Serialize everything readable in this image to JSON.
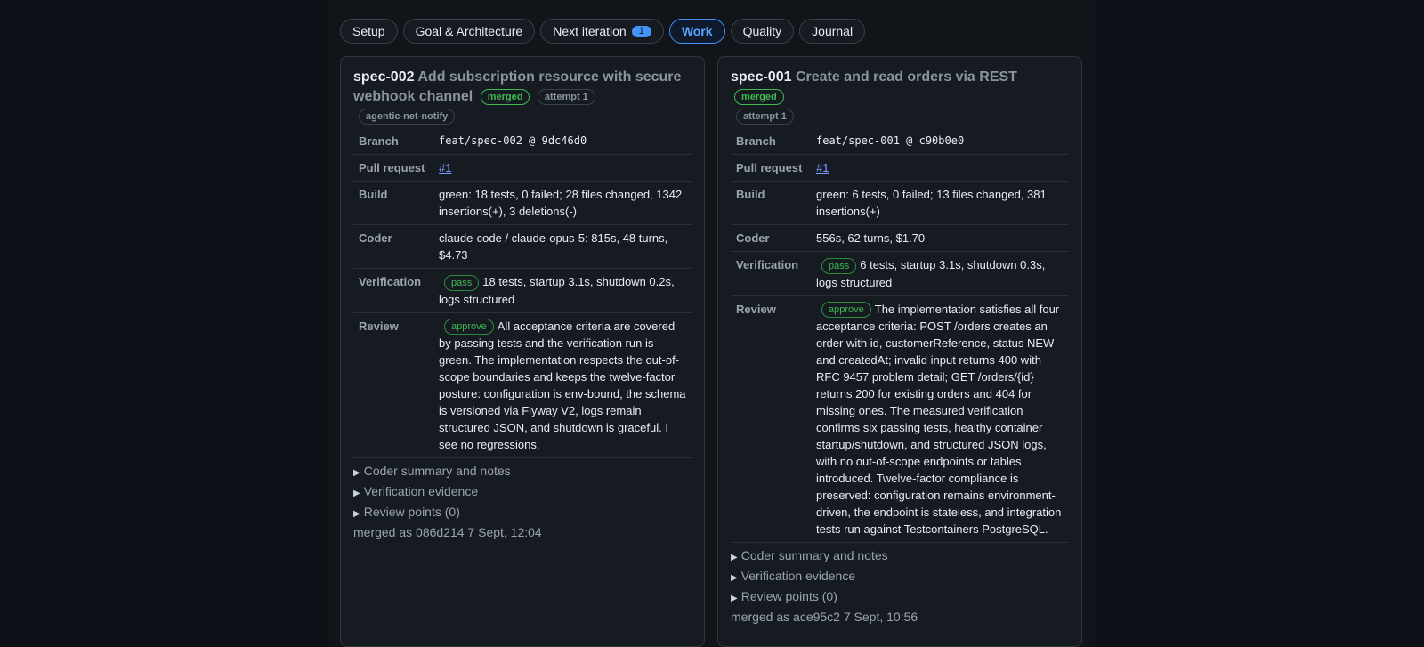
{
  "tabs": [
    {
      "label": "Setup"
    },
    {
      "label": "Goal & Architecture"
    },
    {
      "label": "Next iteration",
      "count": "1"
    },
    {
      "label": "Work"
    },
    {
      "label": "Quality"
    },
    {
      "label": "Journal"
    }
  ],
  "cards": [
    {
      "id": "spec-002",
      "title": "Add subscription resource with secure webhook channel",
      "status": "merged",
      "attempt": "attempt 1",
      "tag": "agentic-net-notify",
      "labels": {
        "branch": "Branch",
        "pr": "Pull request",
        "build": "Build",
        "coder": "Coder",
        "verification": "Verification",
        "review": "Review"
      },
      "branch": "feat/spec-002 @ 9dc46d0",
      "pr": "#1",
      "build": "green: 18 tests, 0 failed; 28 files changed, 1342 insertions(+), 3 deletions(-)",
      "coder": "claude-code / claude-opus-5: 815s, 48 turns, $4.73",
      "verification_badge": "pass",
      "verification": "18 tests, startup 3.1s, shutdown 0.2s, logs structured",
      "review_badge": "approve",
      "review": "All acceptance criteria are covered by passing tests and the verification run is green. The implementation respects the out-of-scope boundaries and keeps the twelve-factor posture: configuration is env-bound, the schema is versioned via Flyway V2, logs remain structured JSON, and shutdown is graceful. I see no regressions.",
      "details": [
        "Coder summary and notes",
        "Verification evidence",
        "Review points (0)"
      ],
      "merged": "merged as 086d214 7 Sept, 12:04"
    },
    {
      "id": "spec-001",
      "title": "Create and read orders via REST",
      "status": "merged",
      "attempt": "attempt 1",
      "labels": {
        "branch": "Branch",
        "pr": "Pull request",
        "build": "Build",
        "coder": "Coder",
        "verification": "Verification",
        "review": "Review"
      },
      "branch": "feat/spec-001 @ c90b0e0",
      "pr": "#1",
      "build": "green: 6 tests, 0 failed; 13 files changed, 381 insertions(+)",
      "coder": "556s, 62 turns, $1.70",
      "verification_badge": "pass",
      "verification": "6 tests, startup 3.1s, shutdown 0.3s, logs structured",
      "review_badge": "approve",
      "review": "The implementation satisfies all four acceptance criteria: POST /orders creates an order with id, customerReference, status NEW and createdAt; invalid input returns 400 with RFC 9457 problem detail; GET /orders/{id} returns 200 for existing orders and 404 for missing ones. The measured verification confirms six passing tests, healthy container startup/shutdown, and structured JSON logs, with no out-of-scope endpoints or tables introduced. Twelve-factor compliance is preserved: configuration remains environment-driven, the endpoint is stateless, and integration tests run against Testcontainers PostgreSQL.",
      "details": [
        "Coder summary and notes",
        "Verification evidence",
        "Review points (0)"
      ],
      "merged": "merged as ace95c2 7 Sept, 10:56"
    }
  ],
  "colors": {
    "accent": "#4493f8",
    "success": "#3fb950",
    "background": "#0d1117",
    "card": "#161b22"
  }
}
